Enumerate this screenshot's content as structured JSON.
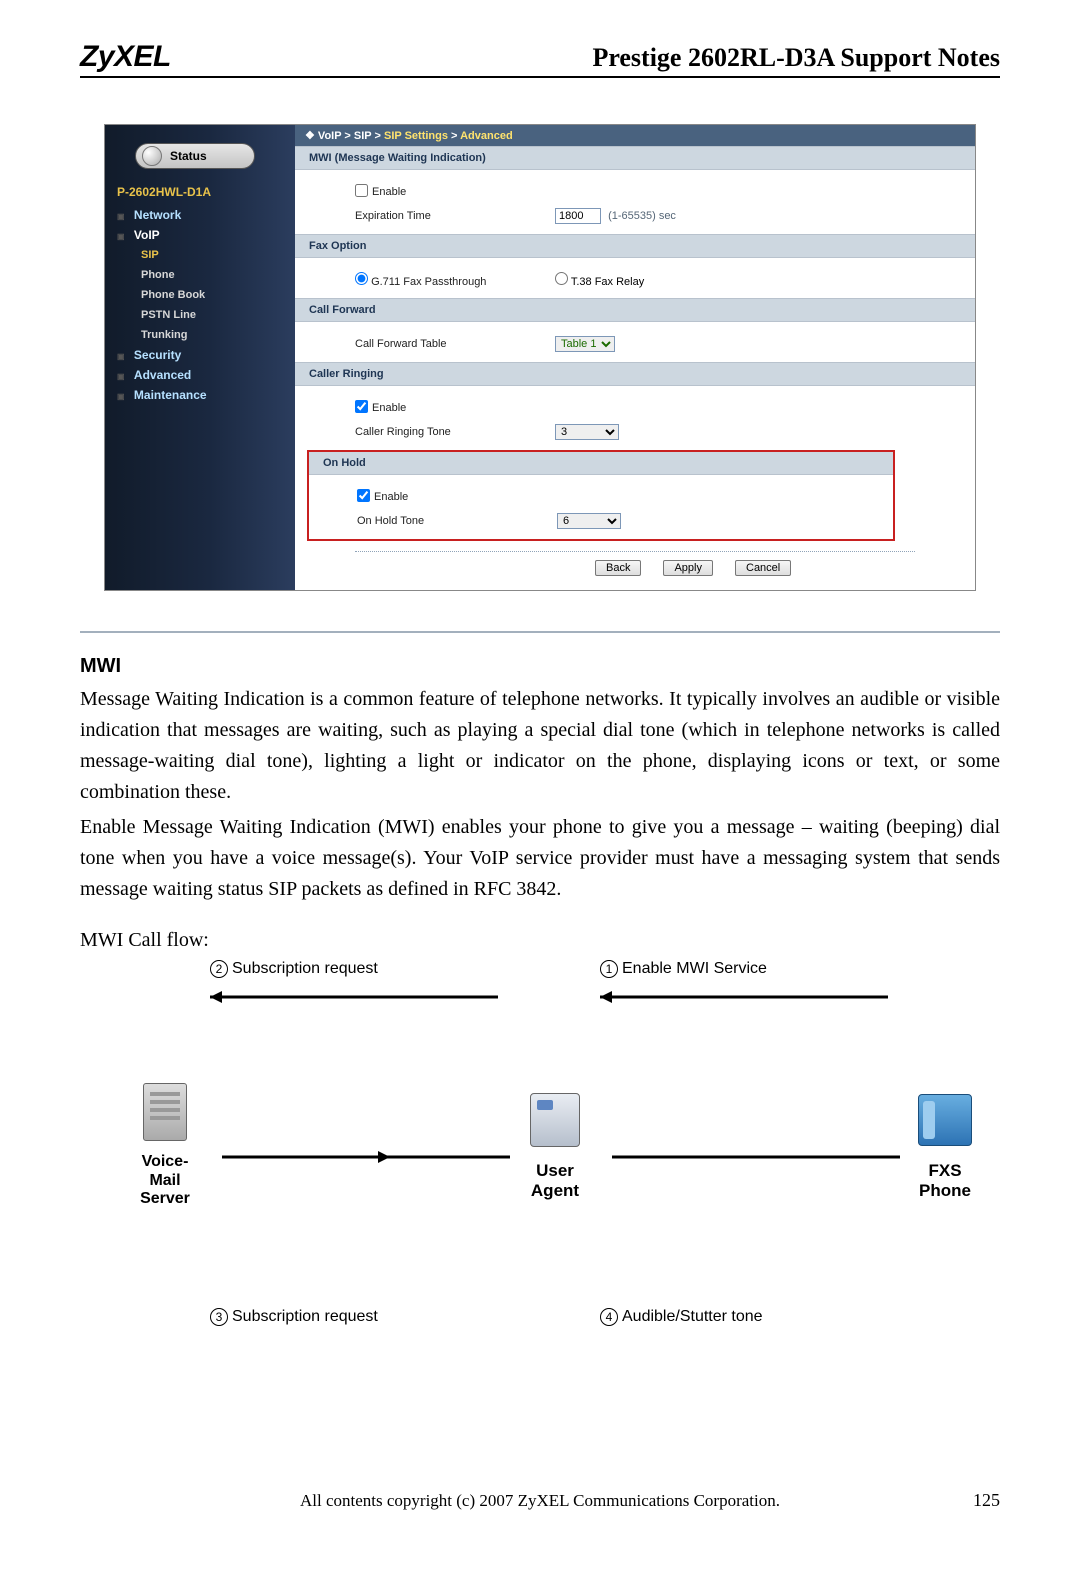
{
  "header": {
    "logo": "ZyXEL",
    "title": "Prestige 2602RL-D3A Support Notes"
  },
  "sidebar": {
    "status_label": "Status",
    "product": "P-2602HWL-D1A",
    "items": [
      {
        "label": "Network",
        "expanded": false
      },
      {
        "label": "VoIP",
        "expanded": true,
        "children": [
          {
            "label": "SIP",
            "active": true
          },
          {
            "label": "Phone"
          },
          {
            "label": "Phone Book"
          },
          {
            "label": "PSTN Line"
          },
          {
            "label": "Trunking"
          }
        ]
      },
      {
        "label": "Security",
        "expanded": false
      },
      {
        "label": "Advanced",
        "expanded": false
      },
      {
        "label": "Maintenance",
        "expanded": false
      }
    ]
  },
  "breadcrumb": {
    "parts": [
      "VoIP",
      "SIP",
      "SIP Settings",
      "Advanced"
    ]
  },
  "mwi": {
    "title": "MWI (Message Waiting Indication)",
    "enable_label": "Enable",
    "enable_checked": false,
    "exp_label": "Expiration Time",
    "exp_value": "1800",
    "exp_hint": "(1-65535) sec"
  },
  "fax": {
    "title": "Fax Option",
    "opt1": "G.711 Fax Passthrough",
    "opt2": "T.38 Fax Relay",
    "selected": "g711"
  },
  "fwd": {
    "title": "Call Forward",
    "label": "Call Forward Table",
    "value": "Table 1"
  },
  "ringing": {
    "title": "Caller Ringing",
    "enable_label": "Enable",
    "enable_checked": true,
    "tone_label": "Caller Ringing Tone",
    "tone_value": "3"
  },
  "hold": {
    "title": "On Hold",
    "enable_label": "Enable",
    "enable_checked": true,
    "tone_label": "On Hold Tone",
    "tone_value": "6"
  },
  "buttons": {
    "back": "Back",
    "apply": "Apply",
    "cancel": "Cancel"
  },
  "body": {
    "h2": "MWI",
    "p1": "Message Waiting Indication is a common feature of telephone networks. It typically involves an audible or visible indication that messages are waiting, such as playing a special dial tone (which in telephone networks is called message-waiting dial tone), lighting a light or indicator on the phone, displaying icons or text, or some combination these.",
    "p2": "Enable Message Waiting Indication (MWI) enables your phone to give you a message – waiting (beeping) dial tone when you have a voice message(s). Your VoIP service provider must have a messaging system that sends message waiting status SIP packets as defined in RFC 3842.",
    "flowlabel": "MWI Call flow:"
  },
  "diagram": {
    "node1": "Voice-Mail\nServer",
    "node2": "User Agent",
    "node3": "FXS Phone",
    "a2": "Subscription request",
    "a3": "Subscription request",
    "a1": "Enable MWI Service",
    "a4": "Audible/Stutter tone"
  },
  "footer": {
    "copy": "All contents copyright (c) 2007 ZyXEL Communications Corporation.",
    "page": "125"
  }
}
